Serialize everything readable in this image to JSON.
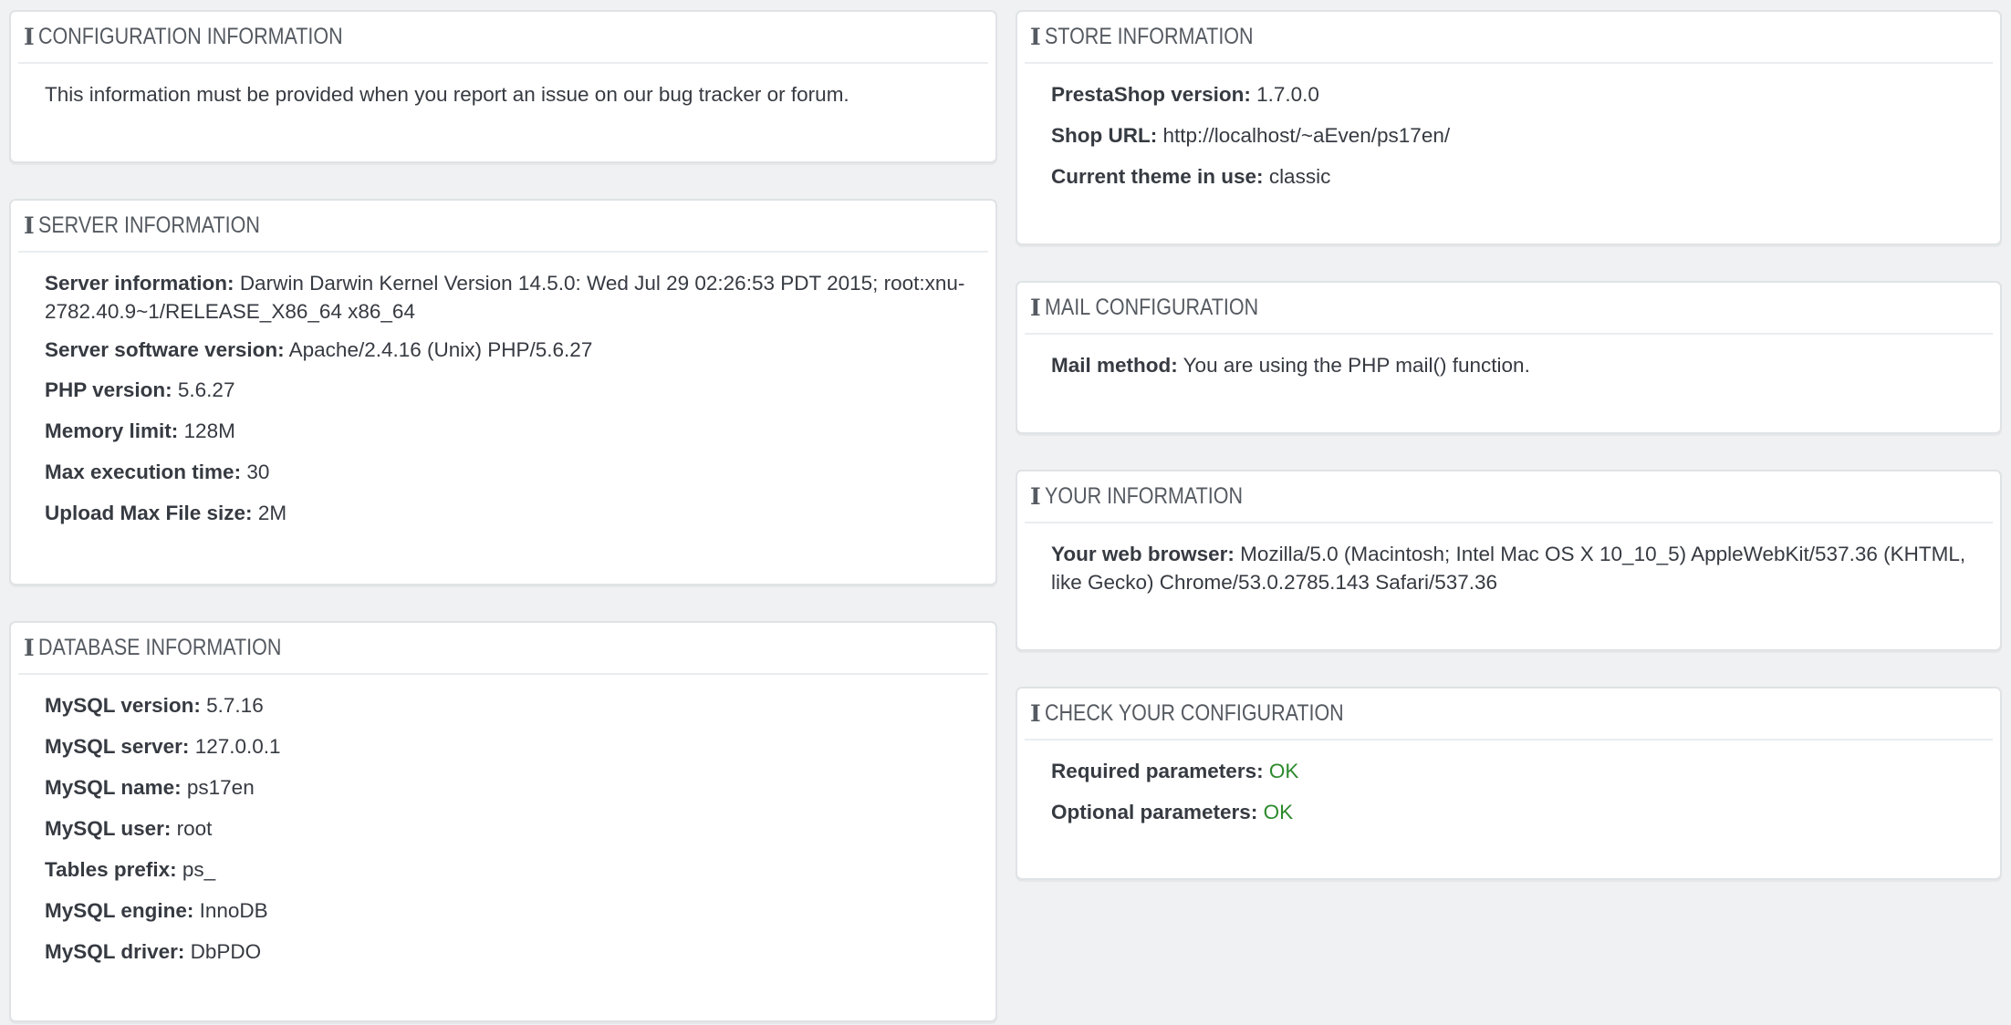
{
  "config_info": {
    "title": "CONFIGURATION INFORMATION",
    "text": "This information must be provided when you report an issue on our bug tracker or forum."
  },
  "server_info": {
    "title": "SERVER INFORMATION",
    "rows": [
      {
        "label": "Server information:",
        "value": "Darwin Darwin Kernel Version 14.5.0: Wed Jul 29 02:26:53 PDT 2015; root:xnu-2782.40.9~1/RELEASE_X86_64 x86_64"
      },
      {
        "label": "Server software version:",
        "value": "Apache/2.4.16 (Unix) PHP/5.6.27"
      },
      {
        "label": "PHP version:",
        "value": "5.6.27"
      },
      {
        "label": "Memory limit:",
        "value": "128M"
      },
      {
        "label": "Max execution time:",
        "value": "30"
      },
      {
        "label": "Upload Max File size:",
        "value": "2M"
      }
    ]
  },
  "database_info": {
    "title": "DATABASE INFORMATION",
    "rows": [
      {
        "label": "MySQL version:",
        "value": "5.7.16"
      },
      {
        "label": "MySQL server:",
        "value": "127.0.0.1"
      },
      {
        "label": "MySQL name:",
        "value": "ps17en"
      },
      {
        "label": "MySQL user:",
        "value": "root"
      },
      {
        "label": "Tables prefix:",
        "value": "ps_"
      },
      {
        "label": "MySQL engine:",
        "value": "InnoDB"
      },
      {
        "label": "MySQL driver:",
        "value": "DbPDO"
      }
    ]
  },
  "store_info": {
    "title": "STORE INFORMATION",
    "rows": [
      {
        "label": "PrestaShop version:",
        "value": "1.7.0.0"
      },
      {
        "label": "Shop URL:",
        "value": "http://localhost/~aEven/ps17en/"
      },
      {
        "label": "Current theme in use:",
        "value": "classic"
      }
    ]
  },
  "mail_config": {
    "title": "MAIL CONFIGURATION",
    "rows": [
      {
        "label": "Mail method:",
        "value": "You are using the PHP mail() function."
      }
    ]
  },
  "your_info": {
    "title": "YOUR INFORMATION",
    "rows": [
      {
        "label": "Your web browser:",
        "value": "Mozilla/5.0 (Macintosh; Intel Mac OS X 10_10_5) AppleWebKit/537.36 (KHTML, like Gecko) Chrome/53.0.2785.143 Safari/537.36"
      }
    ]
  },
  "check_config": {
    "title": "CHECK YOUR CONFIGURATION",
    "rows": [
      {
        "label": "Required parameters:",
        "value": "OK"
      },
      {
        "label": "Optional parameters:",
        "value": "OK"
      }
    ]
  },
  "colors": {
    "ok": "#2c8a2c",
    "background": "#eff1f2",
    "panel_border": "#dfe3e6"
  },
  "icons": {
    "panel_heading_icon": "info-icon"
  }
}
